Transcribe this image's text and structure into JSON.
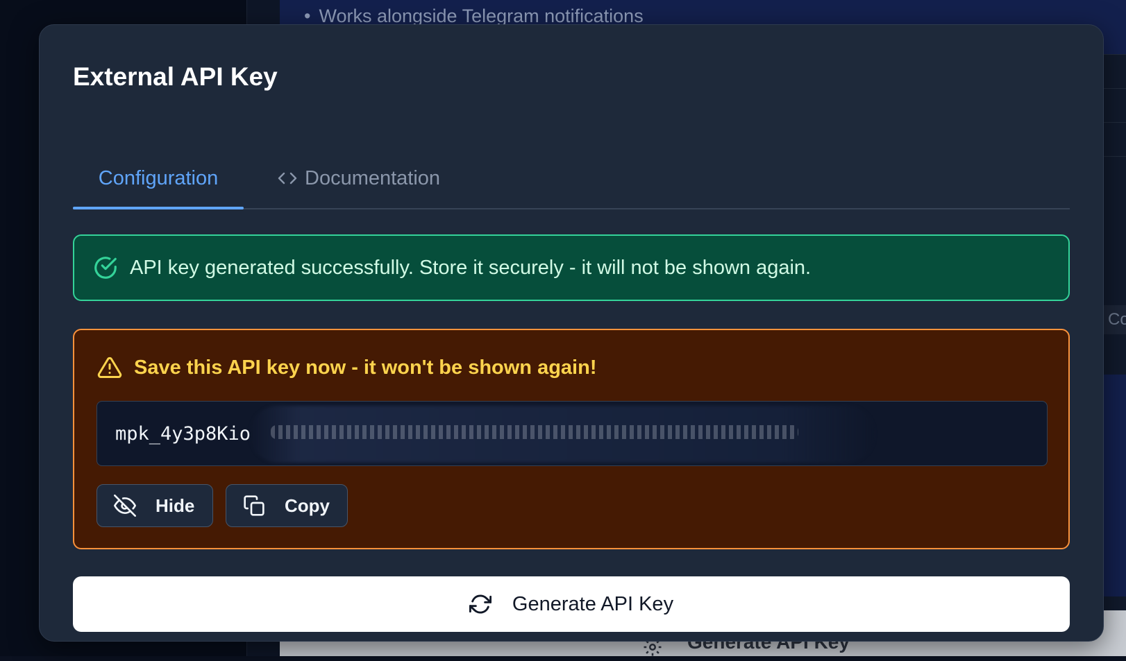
{
  "background": {
    "bullet_text": "Works alongside Telegram notifications",
    "side_label": "Co",
    "bottom_button_label": "Generate API Key"
  },
  "modal": {
    "title": "External API Key",
    "tabs": [
      {
        "label": "Configuration",
        "active": true
      },
      {
        "label": "Documentation",
        "active": false,
        "icon": "code-icon"
      }
    ],
    "success_message": "API key generated successfully. Store it securely - it will not be shown again.",
    "warning": {
      "title": "Save this API key now - it won't be shown again!",
      "key_prefix": "mpk_4y3p8Kio",
      "hide_label": "Hide",
      "copy_label": "Copy"
    },
    "generate_label": "Generate API Key"
  },
  "colors": {
    "modal_bg": "#1e293a",
    "accent": "#60a5fa",
    "success_bg": "#064e3b",
    "success_border": "#34d399",
    "warning_bg": "#451a03",
    "warning_border": "#fb923c",
    "warning_text": "#fcd34d"
  }
}
